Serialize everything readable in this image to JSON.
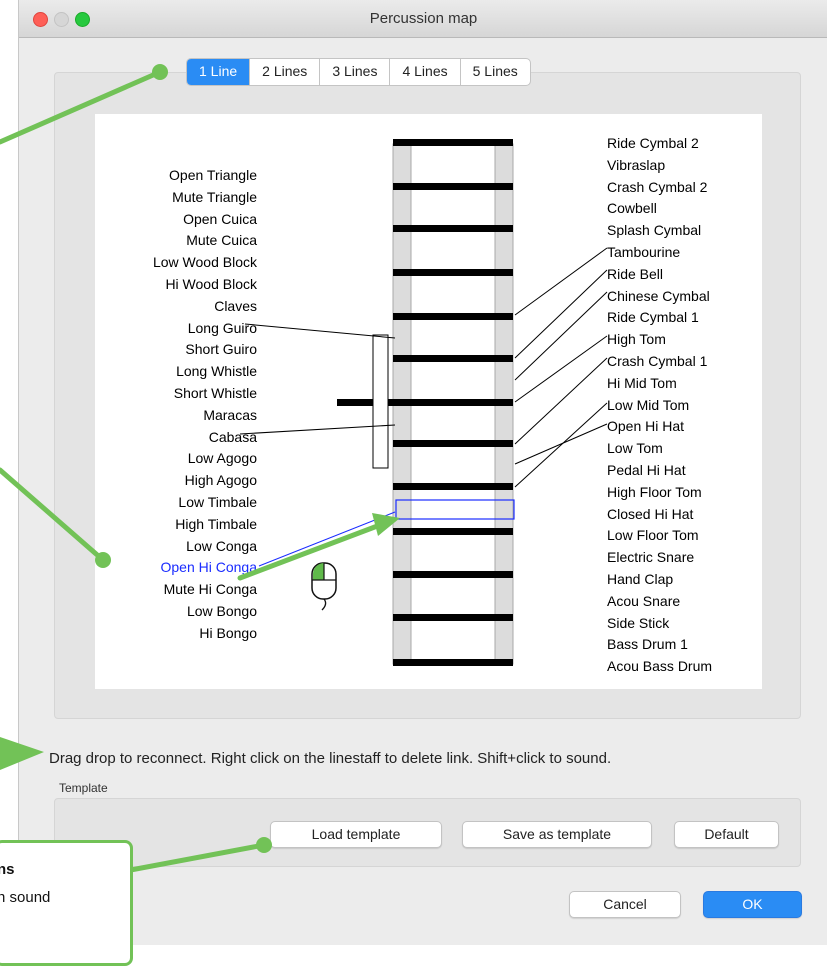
{
  "window": {
    "title": "Percussion map"
  },
  "tabs": [
    {
      "label": "1 Line",
      "active": true
    },
    {
      "label": "2 Lines",
      "active": false
    },
    {
      "label": "3 Lines",
      "active": false
    },
    {
      "label": "4 Lines",
      "active": false
    },
    {
      "label": "5 Lines",
      "active": false
    }
  ],
  "left_instruments": [
    "Open Triangle",
    "Mute Triangle",
    "Open Cuica",
    "Mute Cuica",
    "Low Wood Block",
    "Hi Wood Block",
    "Claves",
    "Long Guiro",
    "Short Guiro",
    "Long Whistle",
    "Short Whistle",
    "Maracas",
    "Cabasa",
    "Low Agogo",
    "High Agogo",
    "Low Timbale",
    "High Timbale",
    "Low Conga",
    "Open Hi Conga",
    "Mute Hi Conga",
    "Low Bongo",
    "Hi Bongo"
  ],
  "right_instruments": [
    "Ride Cymbal 2",
    "Vibraslap",
    "Crash Cymbal 2",
    "Cowbell",
    "Splash Cymbal",
    "Tambourine",
    "Ride Bell",
    "Chinese Cymbal",
    "Ride Cymbal 1",
    "High Tom",
    "Crash Cymbal 1",
    "Hi Mid Tom",
    "Low Mid Tom",
    "Open Hi Hat",
    "Low Tom",
    "Pedal Hi Hat",
    "High Floor Tom",
    "Closed Hi Hat",
    "Low Floor Tom",
    "Electric Snare",
    "Hand Clap",
    "Acou Snare",
    "Side Stick",
    "Bass Drum 1",
    "Acou Bass Drum"
  ],
  "selected_instrument": "Open Hi Conga",
  "hint": "Drag  drop to reconnect. Right click on the linestaff to delete link. Shift+click to sound.",
  "template_group": {
    "label": "Template",
    "load_label": "Load template",
    "save_label": "Save as template",
    "default_label": "Default"
  },
  "footer": {
    "cancel_label": "Cancel",
    "ok_label": "OK"
  },
  "callout": {
    "title": "ns",
    "text": "n sound"
  },
  "colors": {
    "accent": "#2a8cf4",
    "annotation": "#72c257",
    "selection": "#1a2cff"
  }
}
